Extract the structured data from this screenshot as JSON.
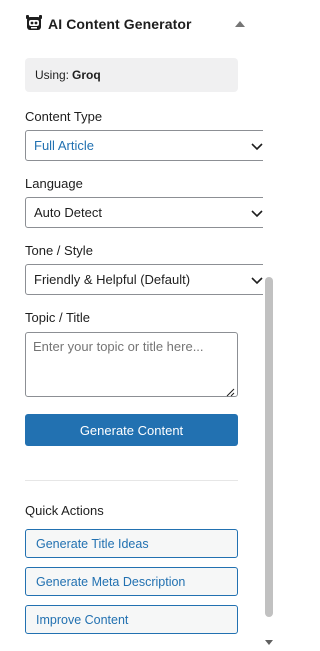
{
  "panel": {
    "title": "AI Content Generator",
    "logo_icon": "robot-icon",
    "collapse_icon": "caret-up-icon"
  },
  "provider": {
    "label": "Using:",
    "value": "Groq"
  },
  "content_type": {
    "label": "Content Type",
    "value": "Full Article",
    "value_color": "#2271b1"
  },
  "language": {
    "label": "Language",
    "value": "Auto Detect"
  },
  "tone": {
    "label": "Tone / Style",
    "value": "Friendly & Helpful (Default)"
  },
  "topic": {
    "label": "Topic / Title",
    "placeholder": "Enter your topic or title here..."
  },
  "generate_button": "Generate Content",
  "quick_actions": {
    "title": "Quick Actions",
    "items": [
      {
        "label": "Generate Title Ideas"
      },
      {
        "label": "Generate Meta Description"
      },
      {
        "label": "Improve Content"
      }
    ]
  },
  "colors": {
    "accent": "#2271b1",
    "text": "#1e1e1e",
    "muted_bg": "#f0f0f1"
  }
}
